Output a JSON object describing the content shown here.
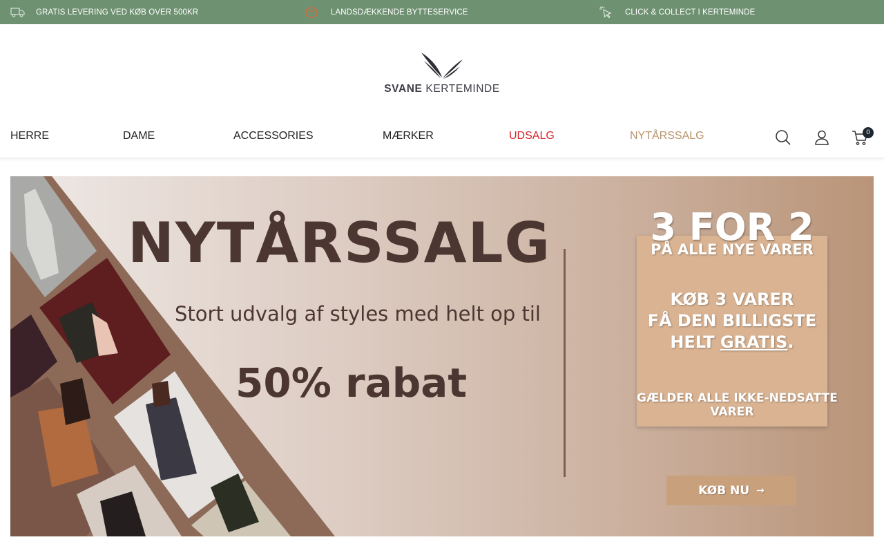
{
  "announcement_bar": {
    "items": [
      {
        "icon": "truck-icon",
        "text": "GRATIS LEVERING VED KØB OVER 500KR"
      },
      {
        "icon": "box-icon",
        "text": "LANDSDÆKKENDE BYTTESERVICE"
      },
      {
        "icon": "pointer-click-icon",
        "text": "CLICK & COLLECT I KERTEMINDE"
      }
    ],
    "background": "#6e9171"
  },
  "logo": {
    "bold": "SVANE",
    "light": "KERTEMINDE"
  },
  "nav": {
    "items": [
      {
        "label": "HERRE"
      },
      {
        "label": "DAME"
      },
      {
        "label": "ACCESSORIES"
      },
      {
        "label": "MÆRKER"
      },
      {
        "label": "UDSALG",
        "color": "#d3222a"
      },
      {
        "label": "NYTÅRSSALG",
        "color": "#b8936a"
      }
    ],
    "icons": [
      "search-icon",
      "user-icon",
      "cart-icon"
    ],
    "cart_count": "0"
  },
  "hero": {
    "title": "NYTÅRSSALG",
    "subtitle": "Stort udvalg af styles med helt op til",
    "discount": "50% rabat",
    "offer": {
      "headline": "3 FOR 2",
      "line1": "PÅ ALLE NYE VARER",
      "line2": "KØB 3 VARER",
      "line3": "FÅ DEN BILLIGSTE",
      "line4_prefix": "HELT ",
      "line4_underlined": "GRATIS",
      "line4_suffix": ".",
      "line5": "GÆLDER ALLE IKKE-NEDSATTE",
      "line6": "VARER"
    },
    "button_label": "KØB NU",
    "button_icon": "arrow-right-icon"
  }
}
